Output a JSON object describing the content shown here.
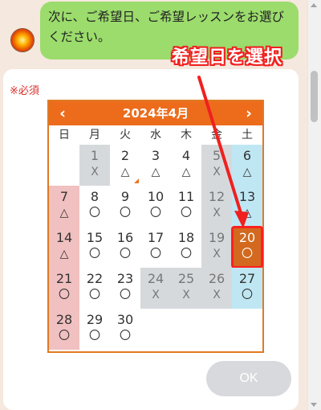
{
  "chat": {
    "message": "次に、ご希望日、ご希望レッスンをお選びください。"
  },
  "form": {
    "required_note": "※必須",
    "ok_label": "OK"
  },
  "calendar": {
    "month_label": "2024年4月",
    "prev_icon": "‹",
    "next_icon": "›",
    "weekdays": [
      "日",
      "月",
      "火",
      "水",
      "木",
      "金",
      "土"
    ],
    "weeks": [
      [
        {
          "day": "",
          "mark": "",
          "status": "empty"
        },
        {
          "day": "1",
          "mark": "X",
          "status": "closed"
        },
        {
          "day": "2",
          "mark": "△",
          "status": "normal"
        },
        {
          "day": "3",
          "mark": "△",
          "status": "normal"
        },
        {
          "day": "4",
          "mark": "△",
          "status": "normal"
        },
        {
          "day": "5",
          "mark": "X",
          "status": "closed"
        },
        {
          "day": "6",
          "mark": "△",
          "status": "sat"
        }
      ],
      [
        {
          "day": "7",
          "mark": "△",
          "status": "sun"
        },
        {
          "day": "8",
          "mark": "〇",
          "status": "normal"
        },
        {
          "day": "9",
          "mark": "〇",
          "status": "normal"
        },
        {
          "day": "10",
          "mark": "〇",
          "status": "normal"
        },
        {
          "day": "11",
          "mark": "〇",
          "status": "normal"
        },
        {
          "day": "12",
          "mark": "X",
          "status": "closed"
        },
        {
          "day": "13",
          "mark": "△",
          "status": "sat"
        }
      ],
      [
        {
          "day": "14",
          "mark": "△",
          "status": "sun"
        },
        {
          "day": "15",
          "mark": "〇",
          "status": "normal"
        },
        {
          "day": "16",
          "mark": "〇",
          "status": "normal"
        },
        {
          "day": "17",
          "mark": "〇",
          "status": "normal"
        },
        {
          "day": "18",
          "mark": "〇",
          "status": "normal"
        },
        {
          "day": "19",
          "mark": "X",
          "status": "closed"
        },
        {
          "day": "20",
          "mark": "〇",
          "status": "selected"
        }
      ],
      [
        {
          "day": "21",
          "mark": "〇",
          "status": "sun"
        },
        {
          "day": "22",
          "mark": "〇",
          "status": "normal"
        },
        {
          "day": "23",
          "mark": "〇",
          "status": "normal"
        },
        {
          "day": "24",
          "mark": "X",
          "status": "closed"
        },
        {
          "day": "25",
          "mark": "X",
          "status": "closed"
        },
        {
          "day": "26",
          "mark": "X",
          "status": "closed"
        },
        {
          "day": "27",
          "mark": "〇",
          "status": "sat"
        }
      ],
      [
        {
          "day": "28",
          "mark": "〇",
          "status": "sun"
        },
        {
          "day": "29",
          "mark": "〇",
          "status": "normal"
        },
        {
          "day": "30",
          "mark": "〇",
          "status": "normal"
        },
        {
          "day": "",
          "mark": "",
          "status": "empty"
        },
        {
          "day": "",
          "mark": "",
          "status": "empty"
        },
        {
          "day": "",
          "mark": "",
          "status": "empty"
        },
        {
          "day": "",
          "mark": "",
          "status": "empty"
        }
      ]
    ]
  },
  "annotation": {
    "label": "希望日を選択"
  },
  "colors": {
    "accent": "#ec6c1c",
    "chat_bubble": "#9bdc6c",
    "annotation": "#f02020"
  }
}
